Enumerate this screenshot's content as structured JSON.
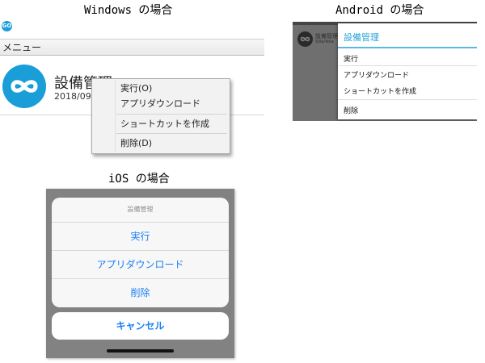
{
  "headings": {
    "windows": "Windows の場合",
    "android": "Android の場合",
    "ios": "iOS の場合"
  },
  "windows": {
    "small_logo_text": "GO",
    "menu_label": "メニュー",
    "app_title": "設備管理",
    "app_date": "2018/09/",
    "context_menu": {
      "run": "実行(O)",
      "download": "アプリダウンロード",
      "shortcut": "ショートカットを作成",
      "delete": "削除(D)"
    },
    "colors": {
      "logo": "#1a9ed8"
    }
  },
  "android": {
    "bg_title": "設備管理",
    "bg_subtitle": "Silla/Vola",
    "dialog_title": "設備管理",
    "items": {
      "run": "実行",
      "download": "アプリダウンロード",
      "shortcut": "ショートカットを作成",
      "delete": "削除"
    },
    "colors": {
      "accent": "#27a3d9"
    }
  },
  "ios": {
    "sheet_title": "設備管理",
    "options": {
      "run": "実行",
      "download": "アプリダウンロード",
      "delete": "削除"
    },
    "cancel": "キャンセル",
    "colors": {
      "action": "#1b7ff5"
    }
  }
}
